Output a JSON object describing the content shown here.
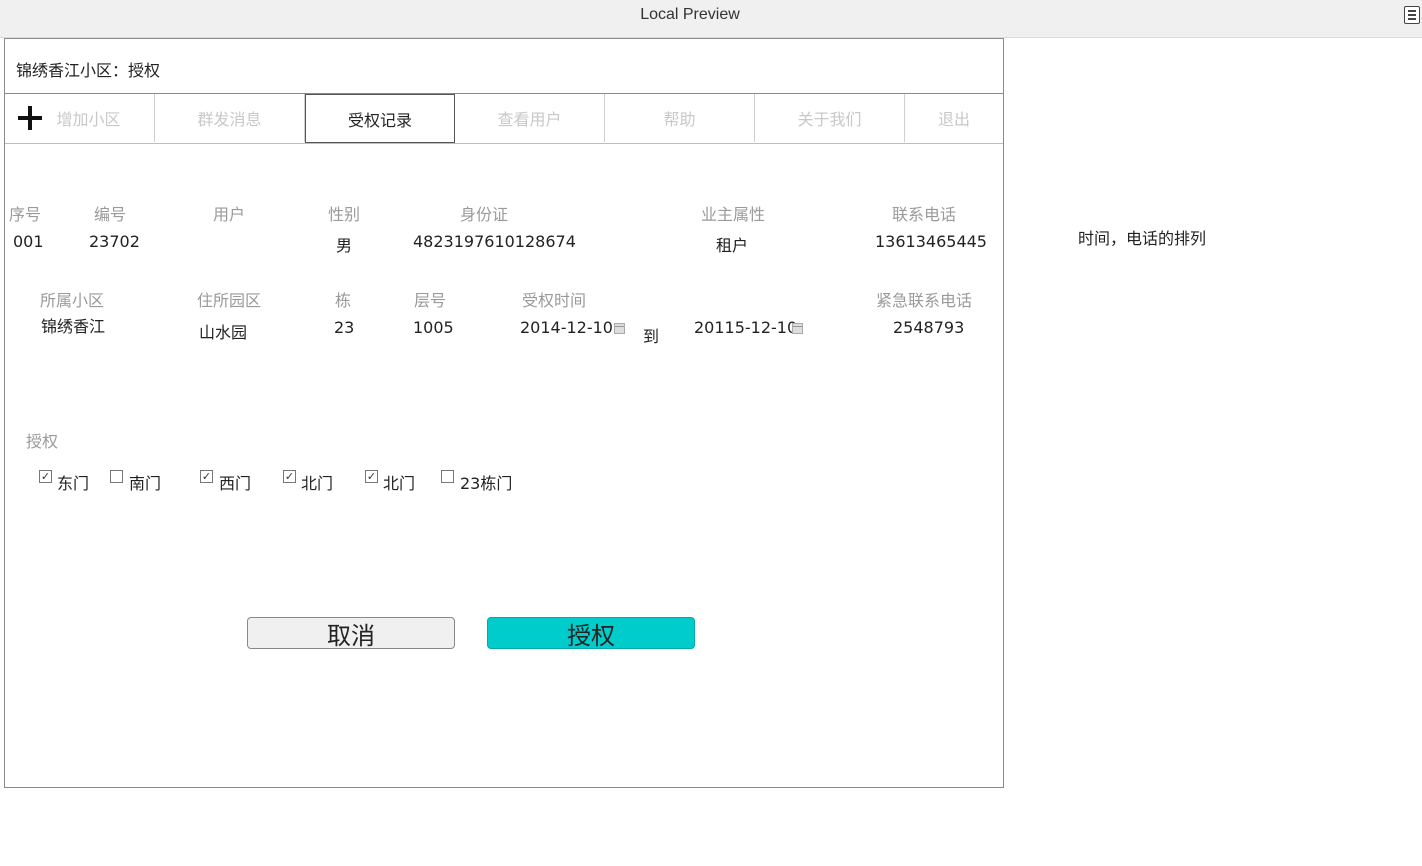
{
  "window": {
    "title": "Local Preview"
  },
  "header": {
    "title": "锦绣香江小区：授权"
  },
  "nav": {
    "tabs": [
      {
        "label": "增加小区"
      },
      {
        "label": "群发消息"
      },
      {
        "label": "受权记录"
      },
      {
        "label": "查看用户"
      },
      {
        "label": "帮助"
      },
      {
        "label": "关于我们"
      },
      {
        "label": "退出"
      }
    ],
    "active": "受权记录"
  },
  "record": {
    "row1_labels": {
      "seq": "序号",
      "code": "编号",
      "user": "用户",
      "gender": "性别",
      "id_card": "身份证",
      "owner_type": "业主属性",
      "phone": "联系电话"
    },
    "row1_values": {
      "seq": "001",
      "code": "23702",
      "user": "",
      "gender": "男",
      "id_card": "4823197610128674",
      "owner_type": "租户",
      "phone": "13613465445"
    },
    "row2_labels": {
      "community": "所属小区",
      "garden": "住所园区",
      "building": "栋",
      "floor": "层号",
      "auth_time": "受权时间",
      "emergency_phone": "紧急联系电话"
    },
    "row2_values": {
      "community": "锦绣香江",
      "garden": "山水园",
      "building": "23",
      "floor": "1005",
      "date_from": "2014-12-10",
      "to": "到",
      "date_to": "20115-12-10",
      "emergency_phone": "2548793"
    }
  },
  "authorization": {
    "label": "授权",
    "gates": [
      {
        "label": "东门",
        "checked": true
      },
      {
        "label": "南门",
        "checked": false
      },
      {
        "label": "西门",
        "checked": true
      },
      {
        "label": "北门",
        "checked": true
      },
      {
        "label": "北门",
        "checked": true
      },
      {
        "label": "23栋门",
        "checked": false
      }
    ]
  },
  "buttons": {
    "cancel": "取消",
    "authorize": "授权"
  },
  "side_note": "时间，电话的排列",
  "colors": {
    "authorize_button": "#00cccc",
    "muted_text": "#9a9a9a"
  }
}
